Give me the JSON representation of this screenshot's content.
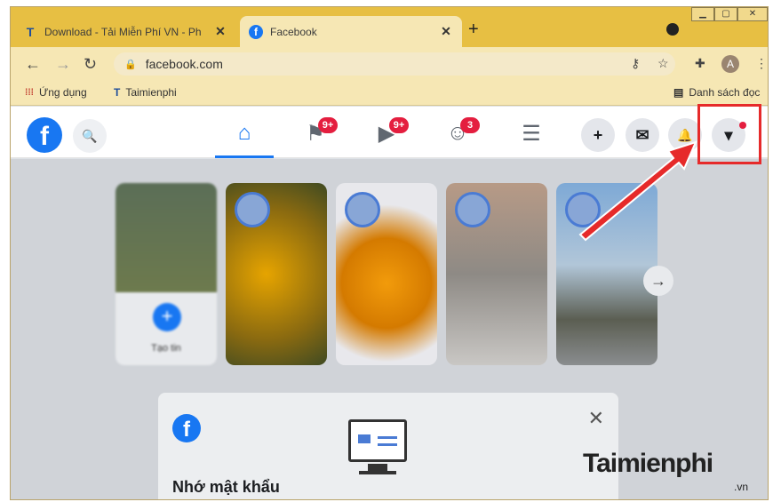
{
  "browser": {
    "tabs": [
      {
        "label": "Download - Tải Miễn Phí VN - Ph",
        "icon": "T",
        "close": "✕"
      },
      {
        "label": "Facebook",
        "icon": "f",
        "close": "✕"
      }
    ],
    "new_tab": "+",
    "address": "facebook.com",
    "nav": {
      "back": "←",
      "forward": "→",
      "reload": "↻"
    },
    "profile_initial": "A",
    "bookmarks": [
      {
        "label": "Ứng dụng",
        "icon": "apps-grid-icon"
      },
      {
        "label": "Taimienphi",
        "icon": "T"
      }
    ],
    "reading_list": "Danh sách đọc"
  },
  "facebook": {
    "nav_badges": {
      "pages": "9+",
      "watch": "9+",
      "groups": "3"
    },
    "header_buttons": {
      "create": "+",
      "messenger": "✉",
      "notifications": "🔔",
      "account": "▾"
    },
    "stories_next": "→",
    "story_create_label": "Tạo tin",
    "card": {
      "close": "✕",
      "title": "Nhớ mật khẩu",
      "logo": "f"
    }
  },
  "watermark": {
    "brand": "Taimienphi",
    "suffix": ".vn"
  },
  "colors": {
    "facebook_blue": "#1877f2",
    "highlight_red": "#e62a2a",
    "browser_theme": "#e7bf43"
  }
}
